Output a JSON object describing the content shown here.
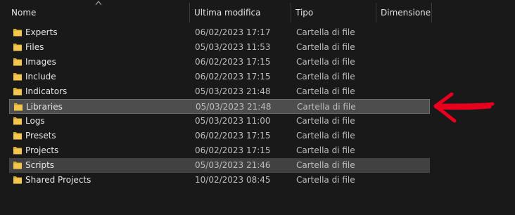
{
  "columns": {
    "name": "Nome",
    "date": "Ultima modifica",
    "type": "Tipo",
    "size": "Dimensione"
  },
  "rows": [
    {
      "name": "Experts",
      "date": "06/02/2023 17:17",
      "type": "Cartella di file",
      "state": "normal"
    },
    {
      "name": "Files",
      "date": "05/03/2023 11:53",
      "type": "Cartella di file",
      "state": "normal"
    },
    {
      "name": "Images",
      "date": "06/02/2023 17:15",
      "type": "Cartella di file",
      "state": "normal"
    },
    {
      "name": "Include",
      "date": "06/02/2023 17:15",
      "type": "Cartella di file",
      "state": "normal"
    },
    {
      "name": "Indicators",
      "date": "05/03/2023 21:48",
      "type": "Cartella di file",
      "state": "normal"
    },
    {
      "name": "Libraries",
      "date": "05/03/2023 21:48",
      "type": "Cartella di file",
      "state": "selected"
    },
    {
      "name": "Logs",
      "date": "05/03/2023 11:00",
      "type": "Cartella di file",
      "state": "normal"
    },
    {
      "name": "Presets",
      "date": "06/02/2023 17:15",
      "type": "Cartella di file",
      "state": "normal"
    },
    {
      "name": "Projects",
      "date": "06/02/2023 17:15",
      "type": "Cartella di file",
      "state": "normal"
    },
    {
      "name": "Scripts",
      "date": "05/03/2023 21:46",
      "type": "Cartella di file",
      "state": "highlighted"
    },
    {
      "name": "Shared Projects",
      "date": "10/02/2023 08:45",
      "type": "Cartella di file",
      "state": "normal"
    }
  ],
  "colors": {
    "background": "#191919",
    "folder": "#f3c64d",
    "annotation": "#e8001c"
  },
  "icons": {
    "folder": "folder-icon",
    "sort": "sort-ascending-icon",
    "annotation": "red-arrow-annotation"
  }
}
